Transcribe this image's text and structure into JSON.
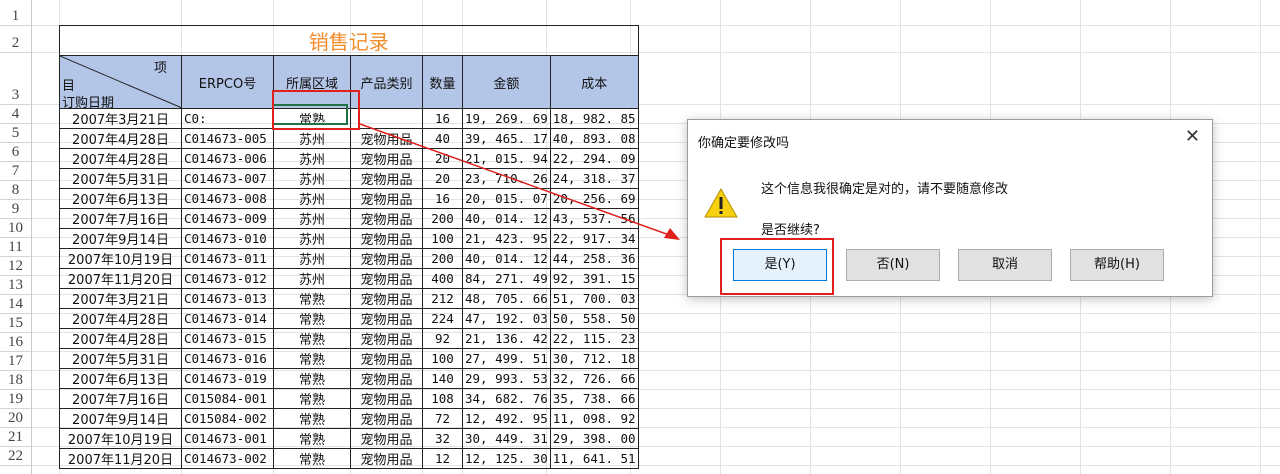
{
  "row_numbers": [
    "1",
    "2",
    "3",
    "4",
    "5",
    "6",
    "7",
    "8",
    "9",
    "10",
    "11",
    "12",
    "13",
    "14",
    "15",
    "16",
    "17",
    "18",
    "19",
    "20",
    "21",
    "22"
  ],
  "table": {
    "title": "销售记录",
    "header_diag_top": "项",
    "header_diag_mid": "目",
    "header_diag_bottom": "订购日期",
    "headers": [
      "ERPCO号",
      "所属区域",
      "产品类别",
      "数量",
      "金额",
      "成本"
    ],
    "rows": [
      [
        "2007年3月21日",
        "C0:",
        "常熟",
        "",
        "16",
        "19, 269. 69",
        "18, 982. 85"
      ],
      [
        "2007年4月28日",
        "C014673-005",
        "苏州",
        "宠物用品",
        "40",
        "39, 465. 17",
        "40, 893. 08"
      ],
      [
        "2007年4月28日",
        "C014673-006",
        "苏州",
        "宠物用品",
        "20",
        "21, 015. 94",
        "22, 294. 09"
      ],
      [
        "2007年5月31日",
        "C014673-007",
        "苏州",
        "宠物用品",
        "20",
        "23, 710. 26",
        "24, 318. 37"
      ],
      [
        "2007年6月13日",
        "C014673-008",
        "苏州",
        "宠物用品",
        "16",
        "20, 015. 07",
        "20, 256. 69"
      ],
      [
        "2007年7月16日",
        "C014673-009",
        "苏州",
        "宠物用品",
        "200",
        "40, 014. 12",
        "43, 537. 56"
      ],
      [
        "2007年9月14日",
        "C014673-010",
        "苏州",
        "宠物用品",
        "100",
        "21, 423. 95",
        "22, 917. 34"
      ],
      [
        "2007年10月19日",
        "C014673-011",
        "苏州",
        "宠物用品",
        "200",
        "40, 014. 12",
        "44, 258. 36"
      ],
      [
        "2007年11月20日",
        "C014673-012",
        "苏州",
        "宠物用品",
        "400",
        "84, 271. 49",
        "92, 391. 15"
      ],
      [
        "2007年3月21日",
        "C014673-013",
        "常熟",
        "宠物用品",
        "212",
        "48, 705. 66",
        "51, 700. 03"
      ],
      [
        "2007年4月28日",
        "C014673-014",
        "常熟",
        "宠物用品",
        "224",
        "47, 192. 03",
        "50, 558. 50"
      ],
      [
        "2007年4月28日",
        "C014673-015",
        "常熟",
        "宠物用品",
        "92",
        "21, 136. 42",
        "22, 115. 23"
      ],
      [
        "2007年5月31日",
        "C014673-016",
        "常熟",
        "宠物用品",
        "100",
        "27, 499. 51",
        "30, 712. 18"
      ],
      [
        "2007年6月13日",
        "C014673-019",
        "常熟",
        "宠物用品",
        "140",
        "29, 993. 53",
        "32, 726. 66"
      ],
      [
        "2007年7月16日",
        "C015084-001",
        "常熟",
        "宠物用品",
        "108",
        "34, 682. 76",
        "35, 738. 66"
      ],
      [
        "2007年9月14日",
        "C015084-002",
        "常熟",
        "宠物用品",
        "72",
        "12, 492. 95",
        "11, 098. 92"
      ],
      [
        "2007年10月19日",
        "C014673-001",
        "常熟",
        "宠物用品",
        "32",
        "30, 449. 31",
        "29, 398. 00"
      ],
      [
        "2007年11月20日",
        "C014673-002",
        "常熟",
        "宠物用品",
        "12",
        "12, 125. 30",
        "11, 641. 51"
      ]
    ]
  },
  "dialog": {
    "title": "你确定要修改吗",
    "close_glyph": "✕",
    "message": "这个信息我很确定是对的，请不要随意修改",
    "question": "是否继续?",
    "buttons": [
      "是(Y)",
      "否(N)",
      "取消",
      "帮助(H)"
    ],
    "icon": "warning-icon"
  },
  "colors": {
    "title": "#f28b2c",
    "header_fill": "#b4c6e7",
    "highlight": "#e0201a",
    "active_cell": "#217346"
  }
}
